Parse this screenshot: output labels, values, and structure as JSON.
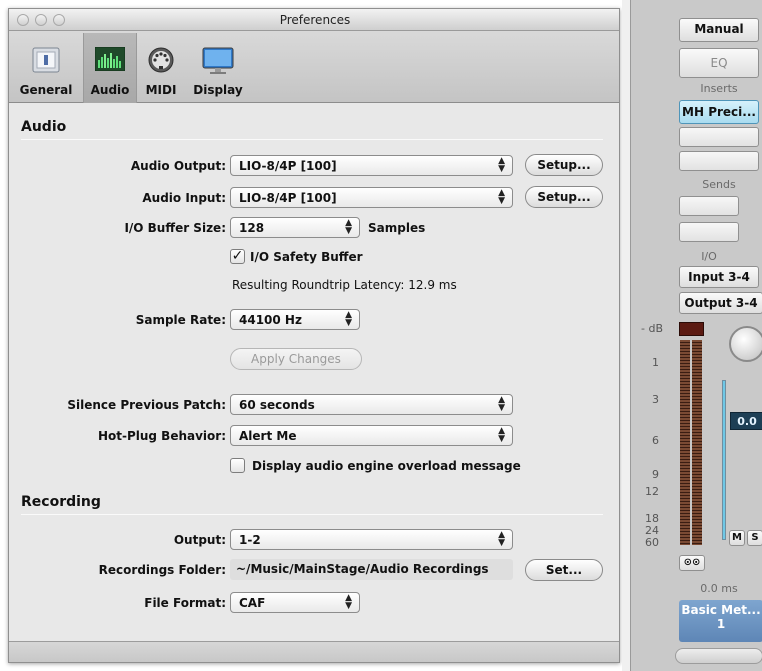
{
  "window": {
    "title": "Preferences",
    "toolbar": [
      {
        "label": "General",
        "icon": "switch-icon"
      },
      {
        "label": "Audio",
        "icon": "audio-meter-icon"
      },
      {
        "label": "MIDI",
        "icon": "midi-connector-icon"
      },
      {
        "label": "Display",
        "icon": "monitor-icon"
      }
    ],
    "active_tab": "Audio"
  },
  "audio": {
    "section_title": "Audio",
    "output_label": "Audio Output:",
    "output_value": "LIO-8/4P [100]",
    "output_setup": "Setup...",
    "input_label": "Audio Input:",
    "input_value": "LIO-8/4P [100]",
    "input_setup": "Setup...",
    "buffer_label": "I/O Buffer Size:",
    "buffer_value": "128",
    "buffer_unit": "Samples",
    "safety_buffer_label": "I/O Safety Buffer",
    "safety_buffer_checked": true,
    "latency_text": "Resulting Roundtrip Latency: 12.9 ms",
    "sample_rate_label": "Sample Rate:",
    "sample_rate_value": "44100 Hz",
    "apply_label": "Apply Changes",
    "silence_label": "Silence Previous Patch:",
    "silence_value": "60 seconds",
    "hotplug_label": "Hot-Plug Behavior:",
    "hotplug_value": "Alert Me",
    "overload_label": "Display audio engine overload message",
    "overload_checked": false
  },
  "recording": {
    "section_title": "Recording",
    "output_label": "Output:",
    "output_value": "1-2",
    "folder_label": "Recordings Folder:",
    "folder_value": "~/Music/MainStage/Audio Recordings",
    "folder_button": "Set...",
    "format_label": "File Format:",
    "format_value": "CAF"
  },
  "mixer": {
    "manual": "Manual",
    "eq": "EQ",
    "inserts_label": "Inserts",
    "insert_1": "MH Preci...",
    "sends_label": "Sends",
    "io_label": "I/O",
    "input": "Input 3-4",
    "output": "Output 3-4",
    "db_label": "- dB",
    "db_scale": [
      "1",
      "3",
      "6",
      "9",
      "12",
      "18",
      "24",
      "60"
    ],
    "fader_value": "0.0",
    "mute": "M",
    "solo": "S",
    "delay": "0.0 ms",
    "channel_name": "Basic Met...",
    "channel_number": "1"
  }
}
